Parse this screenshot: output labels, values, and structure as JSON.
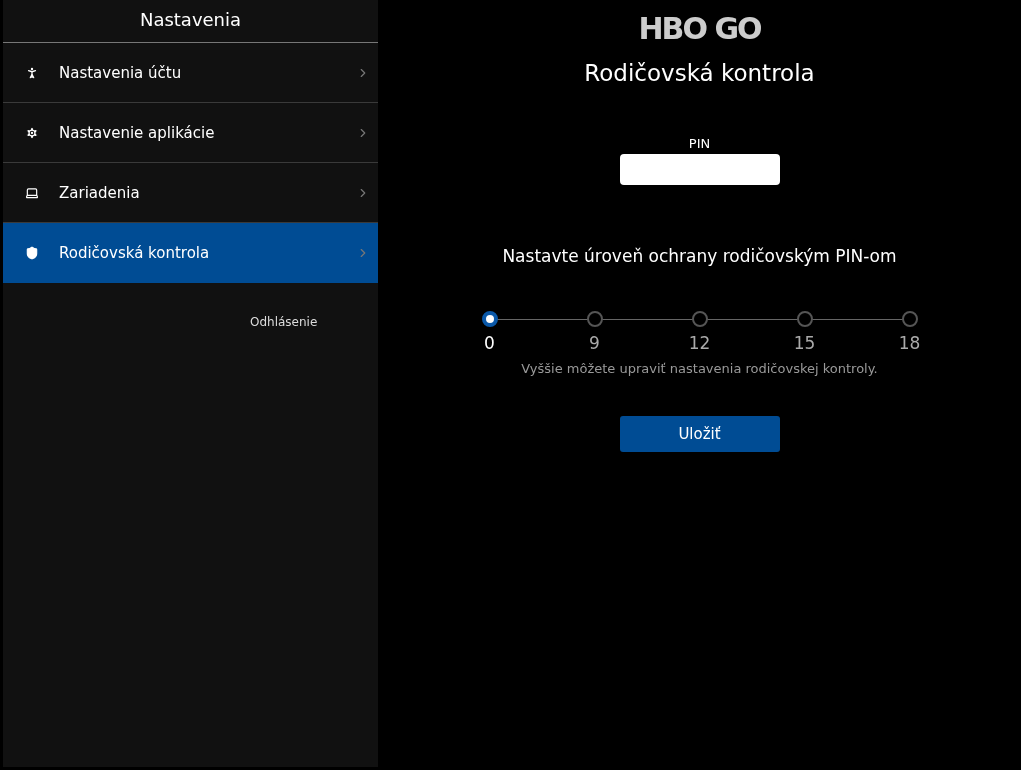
{
  "sidebar": {
    "title": "Nastavenia",
    "items": [
      {
        "kind": "account",
        "label": "Nastavenia účtu",
        "selected": false
      },
      {
        "kind": "app",
        "label": "Nastavenie aplikácie",
        "selected": false
      },
      {
        "kind": "devices",
        "label": "Zariadenia",
        "selected": false
      },
      {
        "kind": "parental",
        "label": "Rodičovská kontrola",
        "selected": true
      }
    ],
    "logout": "Odhlásenie"
  },
  "main": {
    "logo": "HBO GO",
    "title": "Rodičovská kontrola",
    "pin_label": "PIN",
    "level_heading": "Nastavte úroveň ochrany rodičovským PIN-om",
    "ratings": [
      {
        "label": "0",
        "selected": true
      },
      {
        "label": "9",
        "selected": false
      },
      {
        "label": "12",
        "selected": false
      },
      {
        "label": "15",
        "selected": false
      },
      {
        "label": "18",
        "selected": false
      }
    ],
    "hint": "Vyššie môžete upraviť nastavenia rodičovskej kontroly.",
    "save": "Uložiť"
  }
}
